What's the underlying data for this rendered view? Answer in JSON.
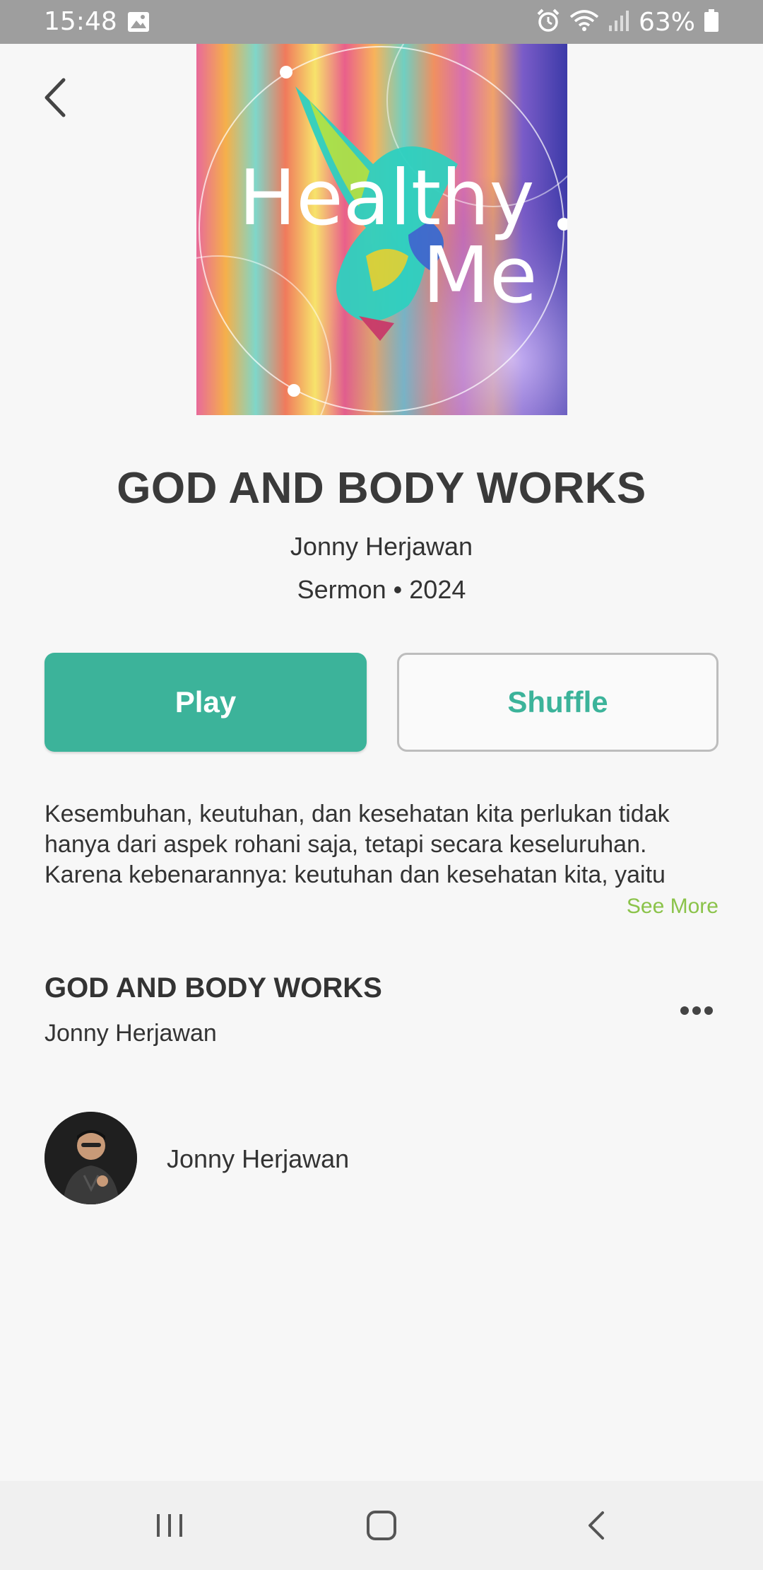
{
  "status_bar": {
    "time": "15:48",
    "battery_percent": "63%",
    "icons": [
      "gallery-icon",
      "alarm-icon",
      "wifi-icon",
      "signal-icon",
      "battery-icon"
    ]
  },
  "cover": {
    "title_line1": "Healthy",
    "title_line2": "Me"
  },
  "album": {
    "title": "GOD AND BODY WORKS",
    "artist": "Jonny Herjawan",
    "meta": "Sermon • 2024"
  },
  "actions": {
    "play_label": "Play",
    "shuffle_label": "Shuffle"
  },
  "description": {
    "text": "Kesembuhan, keutuhan, dan kesehatan kita perlukan tidak hanya dari aspek rohani saja, tetapi secara keseluruhan. Karena kebenarannya: keutuhan dan kesehatan kita, yaitu",
    "see_more_label": "See More"
  },
  "track": {
    "title": "GOD AND BODY WORKS",
    "artist": "Jonny Herjawan"
  },
  "speaker": {
    "name": "Jonny Herjawan"
  },
  "colors": {
    "accent": "#3cb39a",
    "see_more": "#8bc34a",
    "status_bar": "#9e9e9e",
    "background": "#f7f7f7"
  }
}
